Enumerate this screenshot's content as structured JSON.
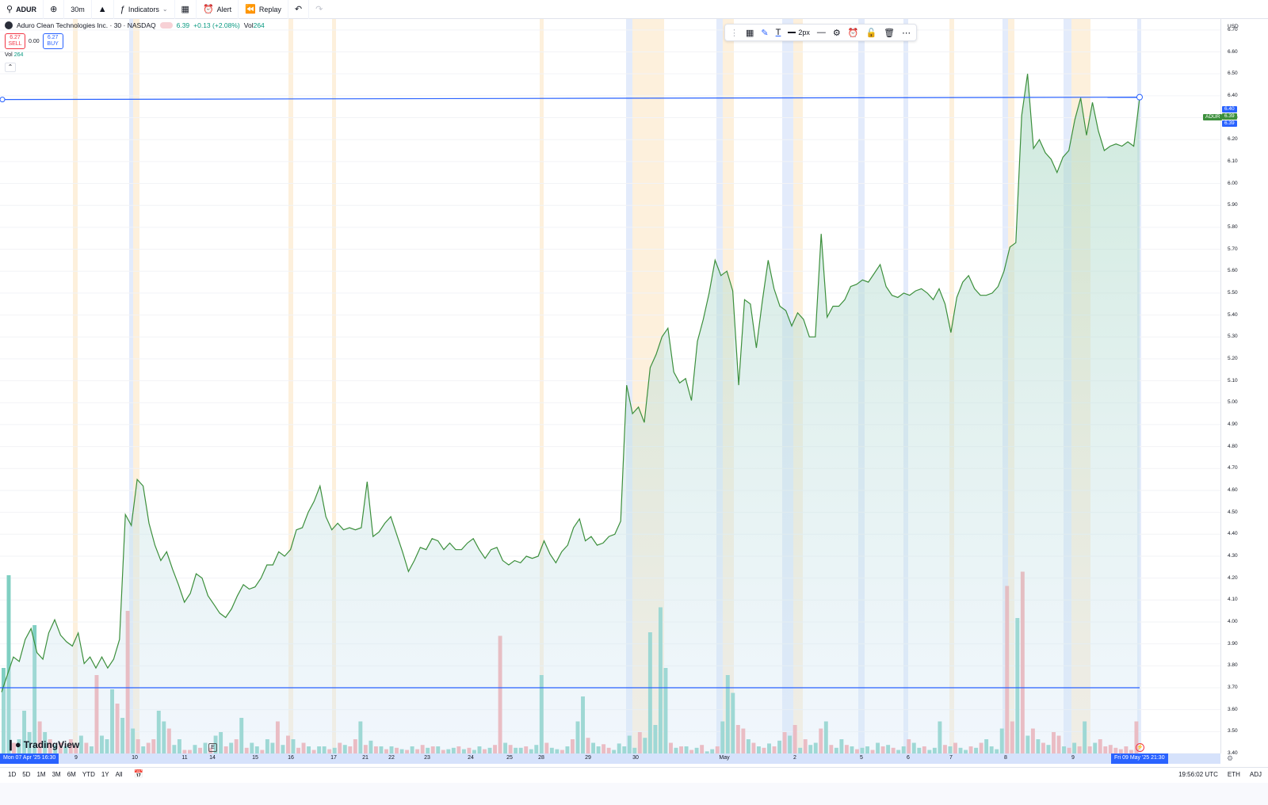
{
  "toolbar": {
    "symbol": "ADUR",
    "interval": "30m",
    "indicators_label": "Indicators",
    "alert_label": "Alert",
    "replay_label": "Replay"
  },
  "legend": {
    "title": "Aduro Clean Technologies Inc. · 30 · NASDAQ",
    "last": "6.39",
    "change": "+0.13 (+2.08%)",
    "vol_label": "Vol",
    "vol_value": "264"
  },
  "trade": {
    "sell_price": "6.27",
    "sell_label": "SELL",
    "spread": "0.00",
    "buy_price": "6.27",
    "buy_label": "BUY"
  },
  "volume_legend": {
    "label": "Vol",
    "value": "264"
  },
  "draw_toolbar": {
    "width_label": "2px"
  },
  "price_axis": {
    "currency": "USD",
    "ticks": [
      "6.70",
      "6.60",
      "6.50",
      "6.40",
      "6.30",
      "6.20",
      "6.10",
      "6.00",
      "5.90",
      "5.80",
      "5.70",
      "5.60",
      "5.50",
      "5.40",
      "5.30",
      "5.20",
      "5.10",
      "5.00",
      "4.90",
      "4.80",
      "4.70",
      "4.60",
      "4.50",
      "4.40",
      "4.30",
      "4.20",
      "4.10",
      "4.00",
      "3.90",
      "3.80",
      "3.70",
      "3.60",
      "3.50",
      "3.40"
    ],
    "symbol_tag": "ADUR",
    "tag_top": "6.40",
    "tag_mid": "6.39",
    "tag_bottom": "6.39"
  },
  "time_axis": {
    "start_label": "Mon 07 Apr '25   16:30",
    "end_label": "Fri 09 May '25   21:30",
    "ticks": [
      "9",
      "10",
      "11",
      "14",
      "15",
      "16",
      "17",
      "21",
      "22",
      "23",
      "24",
      "25",
      "28",
      "29",
      "30",
      "May",
      "2",
      "5",
      "6",
      "7",
      "8",
      "9"
    ]
  },
  "ranges": [
    "1D",
    "5D",
    "1M",
    "3M",
    "6M",
    "YTD",
    "1Y",
    "All"
  ],
  "status": {
    "clock": "19:56:02 UTC",
    "session": "ETH",
    "adj": "ADJ"
  },
  "branding": {
    "logo_text": "TradingView",
    "earnings_marker": "E"
  },
  "colors": {
    "line": "#3c8f3c",
    "accent": "#2962ff",
    "up": "#089981",
    "down": "#f23645"
  },
  "chart_data": {
    "type": "area",
    "title": "Aduro Clean Technologies Inc. · 30 · NASDAQ",
    "xlabel": "",
    "ylabel": "",
    "ylim": [
      3.4,
      6.75
    ],
    "horizontal_lines": [
      6.39,
      3.7
    ],
    "x_range": [
      "Mon 07 Apr '25 16:30",
      "Fri 09 May '25 21:30"
    ],
    "series": [
      {
        "values": [
          3.68,
          3.76,
          3.84,
          3.82,
          3.92,
          3.97,
          3.86,
          3.83,
          3.95,
          4.01,
          3.94,
          3.91,
          3.89,
          3.95,
          3.81,
          3.84,
          3.79,
          3.84,
          3.79,
          3.83,
          3.92,
          4.49,
          4.44,
          4.65,
          4.62,
          4.45,
          4.35,
          4.28,
          4.32,
          4.24,
          4.17,
          4.09,
          4.13,
          4.22,
          4.2,
          4.12,
          4.08,
          4.04,
          4.02,
          4.06,
          4.12,
          4.17,
          4.15,
          4.16,
          4.2,
          4.26,
          4.26,
          4.32,
          4.3,
          4.33,
          4.42,
          4.43,
          4.5,
          4.55,
          4.62,
          4.48,
          4.42,
          4.45,
          4.42,
          4.43,
          4.42,
          4.43,
          4.64,
          4.39,
          4.41,
          4.45,
          4.48,
          4.4,
          4.32,
          4.23,
          4.28,
          4.34,
          4.33,
          4.38,
          4.37,
          4.33,
          4.36,
          4.33,
          4.33,
          4.36,
          4.38,
          4.33,
          4.29,
          4.33,
          4.34,
          4.28,
          4.26,
          4.28,
          4.27,
          4.3,
          4.29,
          4.3,
          4.37,
          4.31,
          4.27,
          4.32,
          4.35,
          4.43,
          4.47,
          4.37,
          4.39,
          4.35,
          4.36,
          4.39,
          4.4,
          4.46,
          5.08,
          4.95,
          4.98,
          4.91,
          5.16,
          5.22,
          5.3,
          5.34,
          5.14,
          5.09,
          5.11,
          5.01,
          5.28,
          5.38,
          5.5,
          5.65,
          5.58,
          5.6,
          5.51,
          5.08,
          5.47,
          5.45,
          5.25,
          5.46,
          5.65,
          5.52,
          5.44,
          5.42,
          5.35,
          5.41,
          5.38,
          5.3,
          5.3,
          5.77,
          5.39,
          5.44,
          5.44,
          5.47,
          5.53,
          5.54,
          5.56,
          5.55,
          5.59,
          5.63,
          5.53,
          5.49,
          5.48,
          5.5,
          5.49,
          5.51,
          5.52,
          5.5,
          5.47,
          5.52,
          5.45,
          5.32,
          5.48,
          5.55,
          5.58,
          5.52,
          5.49,
          5.49,
          5.5,
          5.53,
          5.6,
          5.71,
          5.73,
          6.31,
          6.5,
          6.16,
          6.2,
          6.14,
          6.11,
          6.05,
          6.12,
          6.15,
          6.29,
          6.39,
          6.22,
          6.37,
          6.24,
          6.15,
          6.17,
          6.18,
          6.17,
          6.19,
          6.17,
          6.39
        ]
      }
    ],
    "volume": {
      "values": [
        120,
        250,
        15,
        20,
        60,
        30,
        180,
        45,
        30,
        20,
        12,
        15,
        10,
        20,
        10,
        25,
        15,
        10,
        110,
        25,
        20,
        90,
        70,
        50,
        200,
        35,
        20,
        10,
        15,
        20,
        60,
        45,
        35,
        12,
        20,
        5,
        5,
        12,
        8,
        15,
        8,
        25,
        30,
        10,
        15,
        20,
        50,
        8,
        15,
        10,
        5,
        20,
        15,
        45,
        12,
        25,
        20,
        8,
        15,
        10,
        5,
        10,
        10,
        6,
        8,
        15,
        12,
        10,
        20,
        45,
        12,
        18,
        10,
        10,
        6,
        10,
        8,
        6,
        5,
        10,
        6,
        12,
        8,
        10,
        10,
        5,
        6,
        8,
        10,
        6,
        8,
        5,
        10,
        6,
        8,
        12,
        165,
        15,
        12,
        8,
        8,
        10,
        6,
        12,
        110,
        15,
        8,
        6,
        5,
        10,
        20,
        45,
        80,
        22,
        15,
        10,
        13,
        8,
        5,
        14,
        10,
        25,
        8,
        30,
        22,
        170,
        40,
        205,
        120,
        15,
        8,
        10,
        10,
        5,
        8,
        12,
        3,
        6,
        10,
        45,
        110,
        85,
        40,
        35,
        20,
        15,
        10,
        8,
        14,
        10,
        18,
        30,
        25,
        40,
        8,
        20,
        12,
        15,
        35,
        45,
        12,
        8,
        20,
        12,
        10,
        6,
        8,
        10,
        5,
        15,
        10,
        12,
        8,
        5,
        10,
        20,
        15,
        8,
        10,
        5,
        8,
        45,
        12,
        10,
        15,
        8,
        5,
        10,
        8,
        15,
        20,
        10,
        6,
        35,
        235,
        45,
        190,
        255,
        25,
        35,
        20,
        15,
        12,
        30,
        25,
        10,
        8,
        15,
        10,
        45,
        10,
        15,
        20,
        10,
        12,
        8,
        6,
        10,
        5,
        45
      ],
      "up": [
        1,
        1,
        0,
        1,
        1,
        1,
        1,
        0,
        1,
        0,
        1,
        0,
        1,
        0,
        0,
        1,
        0,
        1,
        0,
        1,
        1,
        1,
        0,
        1,
        0,
        1,
        0,
        1,
        0,
        0,
        1,
        1,
        0,
        1,
        1,
        0,
        0,
        1,
        0,
        1,
        0,
        1,
        1,
        0,
        1,
        0,
        1,
        0,
        1,
        1,
        0,
        1,
        1,
        0,
        1,
        0,
        1,
        0,
        0,
        1,
        0,
        1,
        1,
        0,
        1,
        0,
        1,
        0,
        0,
        1,
        0,
        1,
        0,
        1,
        0,
        1,
        0,
        1,
        0,
        1,
        0,
        0,
        1,
        0,
        1,
        0,
        1,
        1,
        0,
        1,
        0,
        1,
        1,
        0,
        1,
        0,
        0,
        1,
        0,
        1,
        1,
        0,
        1,
        1,
        1,
        0,
        1,
        1,
        0,
        1,
        0,
        1,
        1,
        0,
        1,
        1,
        0,
        0,
        1,
        1,
        1,
        1,
        1,
        0,
        1,
        1,
        1,
        1,
        1,
        0,
        1,
        0,
        1,
        0,
        1,
        0,
        1,
        1,
        0,
        1,
        1,
        1,
        0,
        0,
        1,
        0,
        1,
        0,
        1,
        0,
        1,
        0,
        1,
        0,
        1,
        0,
        1,
        1,
        0,
        1,
        0,
        1,
        1,
        0,
        1,
        0,
        1,
        1,
        0,
        1,
        0,
        1,
        0,
        1,
        1,
        0,
        1,
        1,
        0,
        1,
        1,
        1,
        0,
        1,
        0,
        1,
        1,
        0,
        1,
        0,
        1,
        1,
        1,
        1,
        0,
        0,
        1,
        0,
        1,
        0,
        1,
        0,
        1,
        0,
        0,
        1,
        0,
        1,
        0,
        1,
        0,
        1
      ]
    }
  }
}
